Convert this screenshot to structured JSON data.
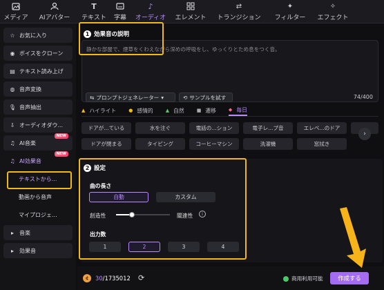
{
  "tabs": [
    {
      "label": "メディア",
      "icon": "media-icon"
    },
    {
      "label": "AIアバター",
      "icon": "avatar-icon"
    },
    {
      "label": "テキスト",
      "icon": "text-icon"
    },
    {
      "label": "字幕",
      "icon": "subtitle-icon"
    },
    {
      "label": "オーディオ",
      "icon": "music-icon"
    },
    {
      "label": "エレメント",
      "icon": "element-icon"
    },
    {
      "label": "トランジション",
      "icon": "transition-icon"
    },
    {
      "label": "フィルター",
      "icon": "filter-icon"
    },
    {
      "label": "エフェクト",
      "icon": "effect-icon"
    }
  ],
  "active_tab": "オーディオ",
  "sidebar": {
    "items": [
      {
        "label": "お気に入り",
        "icon": "star-icon"
      },
      {
        "label": "ボイスをクローン",
        "icon": "clone-icon"
      },
      {
        "label": "テキスト読み上げ",
        "icon": "tts-icon"
      },
      {
        "label": "音声変換",
        "icon": "voice-change-icon"
      },
      {
        "label": "音声抽出",
        "icon": "mic-icon"
      },
      {
        "label": "オーディオダウ...",
        "icon": "download-icon"
      },
      {
        "label": "AI音楽",
        "icon": "ai-music-icon",
        "badge": "NEW"
      },
      {
        "label": "AI効果音",
        "icon": "ai-sfx-icon",
        "badge": "NEW"
      },
      {
        "label": "テキストから...",
        "sub": true
      },
      {
        "label": "動画から音声",
        "sub": true
      },
      {
        "label": "マイプロジェ...",
        "sub": true
      },
      {
        "label": "音楽",
        "icon": "caret-right-icon"
      },
      {
        "label": "効果音",
        "icon": "caret-right-icon"
      }
    ]
  },
  "description": {
    "step": "1",
    "title": "効果音の説明",
    "text": "静かな部屋で、煙草をくわえながら深めの呼吸をし、ゆっくりとため息をつく音。",
    "prompt_generator_label": "プロンプトジェネレーター",
    "try_sample_label": "サンプルを試す",
    "counter": "74/400"
  },
  "categories": [
    {
      "label": "ハイライト",
      "icon": "▲"
    },
    {
      "label": "感情的",
      "icon": "●"
    },
    {
      "label": "自然",
      "icon": "▲"
    },
    {
      "label": "遷移",
      "icon": "■"
    },
    {
      "label": "毎日",
      "icon": "◆",
      "active": true
    }
  ],
  "samples": [
    [
      "ドアが...ている",
      "水を注ぐ",
      "電話の...ション",
      "電子レ...プ音",
      "エレベ...のドア"
    ],
    [
      "ドアが閉まる",
      "タイピング",
      "コーヒーマシン",
      "洗濯機",
      "窓拭き"
    ]
  ],
  "settings": {
    "step": "2",
    "title": "設定",
    "length_label": "曲の長さ",
    "length_options": [
      "自動",
      "カスタム"
    ],
    "length_selected": "自動",
    "creativity_left": "創造性",
    "creativity_right": "關連性",
    "creativity_value": 0.3,
    "output_label": "出力数",
    "output_options": [
      "1",
      "2",
      "3",
      "4"
    ],
    "output_selected": "2"
  },
  "footer": {
    "credits_used": "30",
    "credits_total": "/1735012",
    "commercial_label": "商用利用可能",
    "create_label": "作成する"
  },
  "colors": {
    "accent": "#b98cff",
    "highlight": "#f2bb13",
    "create": "#a46cf0"
  }
}
